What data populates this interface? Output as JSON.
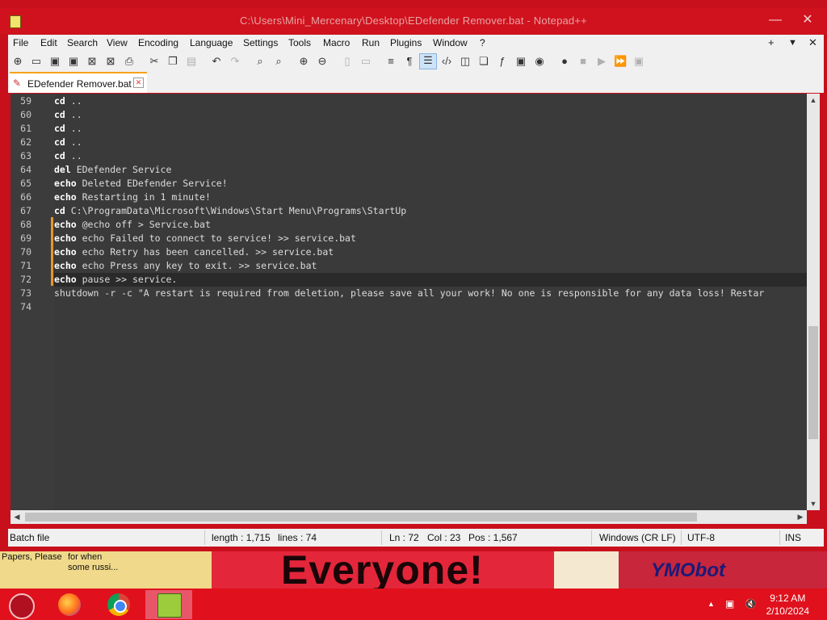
{
  "window": {
    "title": "C:\\Users\\Mini_Mercenary\\Desktop\\EDefender Remover.bat - Notepad++",
    "minimize": "—",
    "maximize": "☐",
    "close": "✕"
  },
  "menu": [
    "File",
    "Edit",
    "Search",
    "View",
    "Encoding",
    "Language",
    "Settings",
    "Tools",
    "Macro",
    "Run",
    "Plugins",
    "Window",
    "?"
  ],
  "menu_right": {
    "add": "+",
    "dropdown": "▼",
    "close": "✕"
  },
  "tab": {
    "label": "EDefender Remover.bat",
    "close": "✕"
  },
  "editor": {
    "lines": [
      {
        "num": "59",
        "kw": "cd",
        "rest": " .."
      },
      {
        "num": "60",
        "kw": "cd",
        "rest": " .."
      },
      {
        "num": "61",
        "kw": "cd",
        "rest": " .."
      },
      {
        "num": "62",
        "kw": "cd",
        "rest": " .."
      },
      {
        "num": "63",
        "kw": "cd",
        "rest": " .."
      },
      {
        "num": "64",
        "kw": "del",
        "rest": " EDefender Service"
      },
      {
        "num": "65",
        "kw": "echo",
        "rest": " Deleted EDefender Service!"
      },
      {
        "num": "66",
        "kw": "echo",
        "rest": " Restarting in 1 minute!"
      },
      {
        "num": "67",
        "kw": "cd",
        "rest": " C:\\ProgramData\\Microsoft\\Windows\\Start Menu\\Programs\\StartUp"
      },
      {
        "num": "68",
        "kw": "echo",
        "rest": " @echo off > Service.bat"
      },
      {
        "num": "69",
        "kw": "echo",
        "rest": " echo Failed to connect to service! >> service.bat"
      },
      {
        "num": "70",
        "kw": "echo",
        "rest": " echo Retry has been cancelled. >> service.bat"
      },
      {
        "num": "71",
        "kw": "echo",
        "rest": " echo Press any key to exit. >> service.bat"
      },
      {
        "num": "72",
        "kw": "echo",
        "rest": " pause >> service."
      },
      {
        "num": "73",
        "kw": "",
        "rest": "shutdown -r -c \"A restart is required from deletion, please save all your work! No one is responsible for any data loss! Restar"
      },
      {
        "num": "74",
        "kw": "",
        "rest": ""
      }
    ]
  },
  "status": {
    "filetype": "Batch file",
    "length": "length : 1,715",
    "lines": "lines : 74",
    "ln": "Ln : 72",
    "col": "Col : 23",
    "pos": "Pos : 1,567",
    "eol": "Windows (CR LF)",
    "encoding": "UTF-8",
    "mode": "INS"
  },
  "desktop": {
    "icon1_label": "Papers, Please",
    "icon2_label": "for when some russi...",
    "banner_text": "Everyone!",
    "right_banner": "YMObot"
  },
  "taskbar": {
    "time": "9:12 AM",
    "date": "2/10/2024",
    "apps": [
      "papers-please",
      "firefox",
      "chrome",
      "notepad-plus-plus"
    ]
  },
  "colors": {
    "accent_tab": "#f7a21b",
    "editor_bg": "#3a3a3a",
    "frame": "#c8101c",
    "taskbar": "#e0101c"
  }
}
